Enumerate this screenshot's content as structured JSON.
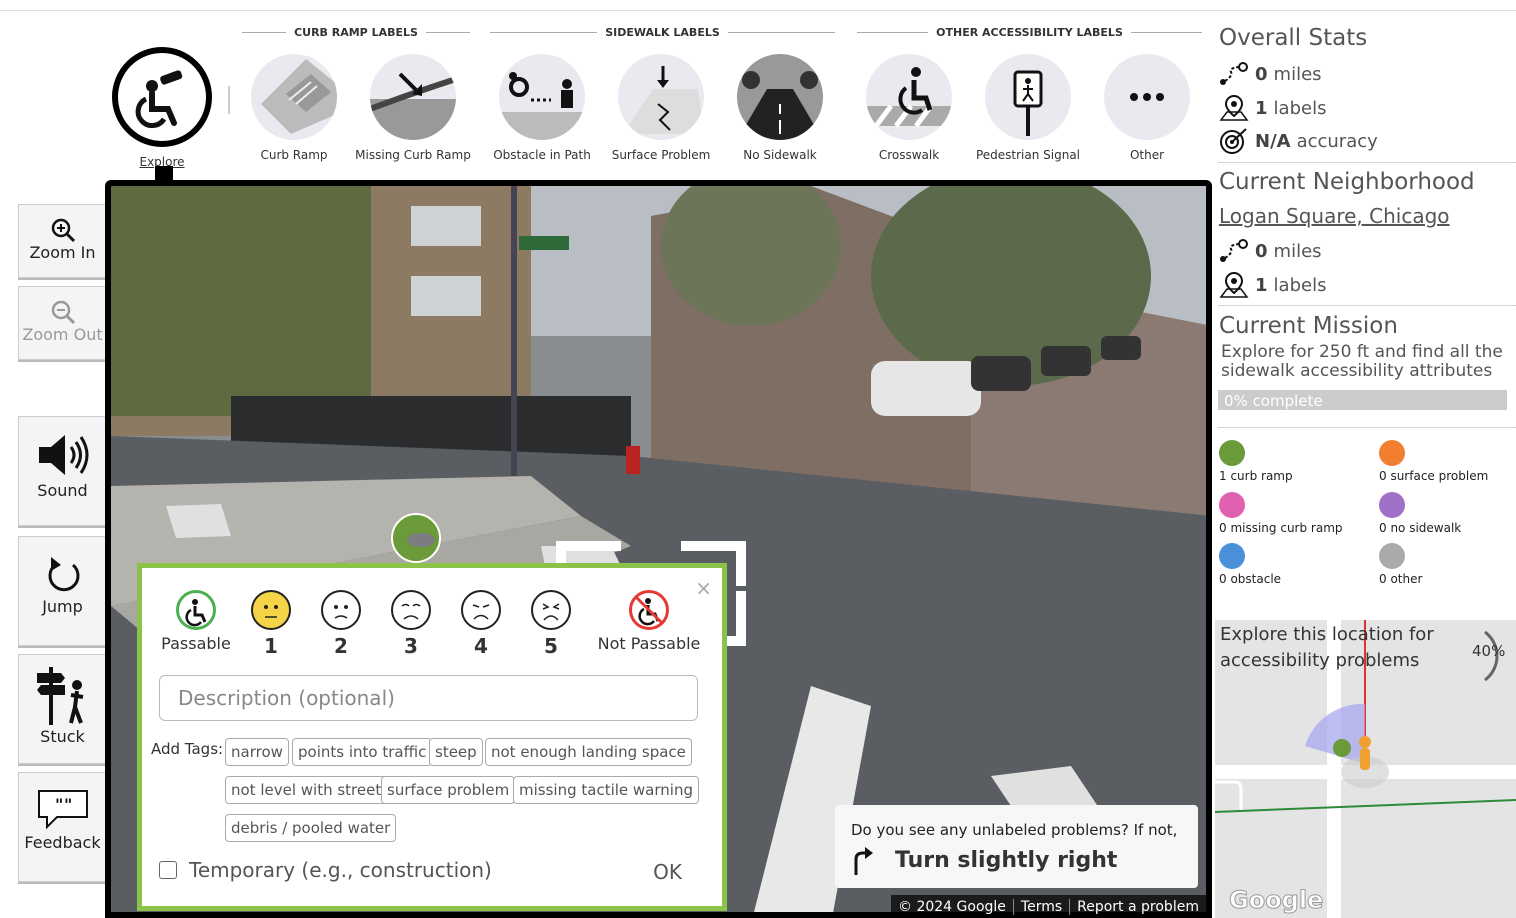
{
  "toolbar": {
    "groups": {
      "curb_ramp": "CURB RAMP LABELS",
      "sidewalk": "SIDEWALK LABELS",
      "other": "OTHER ACCESSIBILITY LABELS"
    },
    "tools": [
      {
        "label": "Explore",
        "icon": "wheelchair-binoculars-icon"
      },
      {
        "label": "Curb Ramp",
        "icon": "curb-ramp-icon"
      },
      {
        "label": "Missing Curb Ramp",
        "icon": "missing-curb-ramp-icon"
      },
      {
        "label": "Obstacle in Path",
        "icon": "obstacle-icon"
      },
      {
        "label": "Surface Problem",
        "icon": "surface-problem-icon"
      },
      {
        "label": "No Sidewalk",
        "icon": "no-sidewalk-icon"
      },
      {
        "label": "Crosswalk",
        "icon": "crosswalk-icon"
      },
      {
        "label": "Pedestrian Signal",
        "icon": "pedestrian-signal-icon"
      },
      {
        "label": "Other",
        "icon": "more-icon"
      }
    ]
  },
  "left_buttons": {
    "zoom_in": "Zoom In",
    "zoom_out": "Zoom Out",
    "sound": "Sound",
    "jump": "Jump",
    "stuck": "Stuck",
    "feedback": "Feedback"
  },
  "popup": {
    "severity": [
      {
        "label": "Passable"
      },
      {
        "label": "1"
      },
      {
        "label": "2"
      },
      {
        "label": "3"
      },
      {
        "label": "4"
      },
      {
        "label": "5"
      },
      {
        "label": "Not Passable"
      }
    ],
    "close": "×",
    "description_placeholder": "Description (optional)",
    "add_tags_label": "Add Tags:",
    "tags": [
      "narrow",
      "points into traffic",
      "steep",
      "not enough landing space",
      "not level with street",
      "surface problem",
      "missing tactile warning",
      "debris / pooled water"
    ],
    "temporary_label": "Temporary (e.g., construction)",
    "ok": "OK"
  },
  "nav_hint": {
    "question": "Do you see any unlabeled problems? If not,",
    "direction": "Turn slightly right"
  },
  "google_bar": [
    "© 2024 Google",
    "Terms",
    "Report a problem"
  ],
  "sidebar": {
    "overall_title": "Overall Stats",
    "overall_miles": "0",
    "overall_miles_unit": "miles",
    "overall_labels": "1",
    "overall_labels_unit": "labels",
    "overall_accuracy": "N/A",
    "overall_accuracy_unit": "accuracy",
    "neighborhood_title": "Current Neighborhood",
    "neighborhood_name": "Logan Square, Chicago",
    "nb_miles": "0",
    "nb_miles_unit": "miles",
    "nb_labels": "1",
    "nb_labels_unit": "labels",
    "mission_title": "Current Mission",
    "mission_text": "Explore for 250 ft and find all the sidewalk accessibility attributes",
    "mission_progress": 0,
    "mission_progress_text": "0% complete",
    "label_counts": [
      {
        "text": "1 curb ramp",
        "color": "#6a9a3a"
      },
      {
        "text": "0 surface problem",
        "color": "#f08030"
      },
      {
        "text": "0 missing curb ramp",
        "color": "#e060b0"
      },
      {
        "text": "0 no sidewalk",
        "color": "#a070c8"
      },
      {
        "text": "0 obstacle",
        "color": "#4a90d9"
      },
      {
        "text": "0 other",
        "color": "#aaaaaa"
      }
    ],
    "minimap_title": "Explore this location for accessibility problems",
    "minimap_percent": "40%",
    "google_logo": "Google"
  },
  "colors": {
    "popup_border": "#8bc34a",
    "passable": "#4caf50",
    "severity1": "#f5d547",
    "not_passable": "#e53935"
  }
}
